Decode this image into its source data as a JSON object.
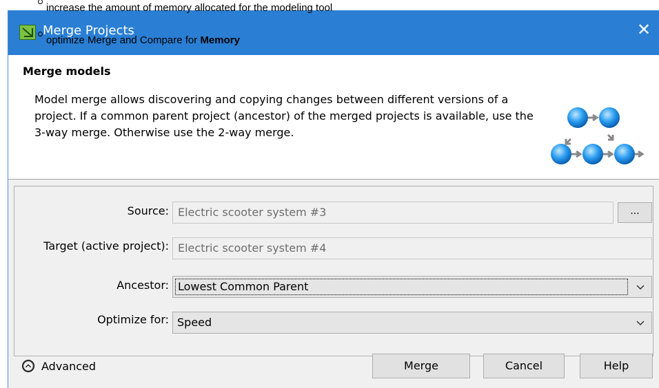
{
  "overlay_text": {
    "line1": "increase the amount of memory allocated for the modeling tool",
    "line2_prefix": "optimize Merge and Compare for ",
    "line2_bold": "Memory"
  },
  "dialog": {
    "title": "Merge Projects",
    "close_glyph": "✕",
    "header": {
      "title": "Merge models",
      "description": "Model merge allows discovering and copying changes between different versions of a project. If a common parent project (ancestor) of the merged projects is available, use the 3-way merge. Otherwise use the 2-way merge."
    },
    "form": {
      "source_label": "Source:",
      "source_value": "Electric scooter system #3",
      "browse_label": "...",
      "target_label": "Target (active project):",
      "target_value": "Electric scooter system #4",
      "ancestor_label": "Ancestor:",
      "ancestor_value": "Lowest Common Parent",
      "optimize_label": "Optimize for:",
      "optimize_value": "Speed"
    },
    "footer": {
      "advanced_label": "Advanced",
      "merge_label": "Merge",
      "cancel_label": "Cancel",
      "help_label": "Help"
    }
  },
  "colors": {
    "titlebar": "#2a7fd4",
    "node_blue": "#1e8fe0"
  },
  "icons": {
    "title": "merge-projects-icon",
    "close": "close-icon",
    "illustration": "merge-diagram-icon",
    "advanced": "chevron-up-circle-icon",
    "dropdown": "chevron-down-icon"
  }
}
